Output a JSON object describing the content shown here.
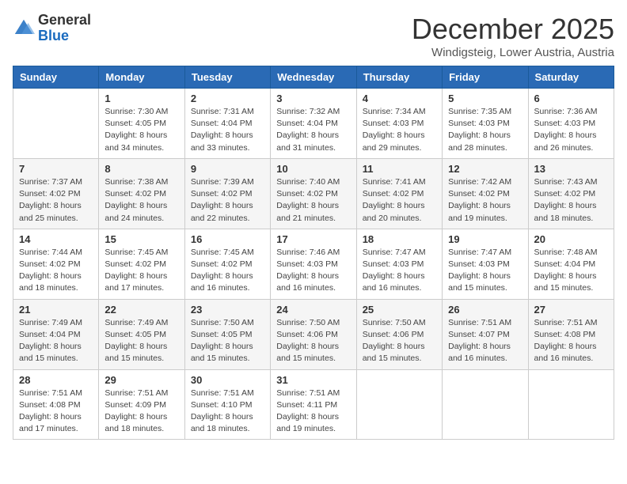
{
  "logo": {
    "general": "General",
    "blue": "Blue"
  },
  "title": "December 2025",
  "location": "Windigsteig, Lower Austria, Austria",
  "days_of_week": [
    "Sunday",
    "Monday",
    "Tuesday",
    "Wednesday",
    "Thursday",
    "Friday",
    "Saturday"
  ],
  "weeks": [
    [
      {
        "day": "",
        "info": ""
      },
      {
        "day": "1",
        "info": "Sunrise: 7:30 AM\nSunset: 4:05 PM\nDaylight: 8 hours\nand 34 minutes."
      },
      {
        "day": "2",
        "info": "Sunrise: 7:31 AM\nSunset: 4:04 PM\nDaylight: 8 hours\nand 33 minutes."
      },
      {
        "day": "3",
        "info": "Sunrise: 7:32 AM\nSunset: 4:04 PM\nDaylight: 8 hours\nand 31 minutes."
      },
      {
        "day": "4",
        "info": "Sunrise: 7:34 AM\nSunset: 4:03 PM\nDaylight: 8 hours\nand 29 minutes."
      },
      {
        "day": "5",
        "info": "Sunrise: 7:35 AM\nSunset: 4:03 PM\nDaylight: 8 hours\nand 28 minutes."
      },
      {
        "day": "6",
        "info": "Sunrise: 7:36 AM\nSunset: 4:03 PM\nDaylight: 8 hours\nand 26 minutes."
      }
    ],
    [
      {
        "day": "7",
        "info": "Sunrise: 7:37 AM\nSunset: 4:02 PM\nDaylight: 8 hours\nand 25 minutes."
      },
      {
        "day": "8",
        "info": "Sunrise: 7:38 AM\nSunset: 4:02 PM\nDaylight: 8 hours\nand 24 minutes."
      },
      {
        "day": "9",
        "info": "Sunrise: 7:39 AM\nSunset: 4:02 PM\nDaylight: 8 hours\nand 22 minutes."
      },
      {
        "day": "10",
        "info": "Sunrise: 7:40 AM\nSunset: 4:02 PM\nDaylight: 8 hours\nand 21 minutes."
      },
      {
        "day": "11",
        "info": "Sunrise: 7:41 AM\nSunset: 4:02 PM\nDaylight: 8 hours\nand 20 minutes."
      },
      {
        "day": "12",
        "info": "Sunrise: 7:42 AM\nSunset: 4:02 PM\nDaylight: 8 hours\nand 19 minutes."
      },
      {
        "day": "13",
        "info": "Sunrise: 7:43 AM\nSunset: 4:02 PM\nDaylight: 8 hours\nand 18 minutes."
      }
    ],
    [
      {
        "day": "14",
        "info": "Sunrise: 7:44 AM\nSunset: 4:02 PM\nDaylight: 8 hours\nand 18 minutes."
      },
      {
        "day": "15",
        "info": "Sunrise: 7:45 AM\nSunset: 4:02 PM\nDaylight: 8 hours\nand 17 minutes."
      },
      {
        "day": "16",
        "info": "Sunrise: 7:45 AM\nSunset: 4:02 PM\nDaylight: 8 hours\nand 16 minutes."
      },
      {
        "day": "17",
        "info": "Sunrise: 7:46 AM\nSunset: 4:03 PM\nDaylight: 8 hours\nand 16 minutes."
      },
      {
        "day": "18",
        "info": "Sunrise: 7:47 AM\nSunset: 4:03 PM\nDaylight: 8 hours\nand 16 minutes."
      },
      {
        "day": "19",
        "info": "Sunrise: 7:47 AM\nSunset: 4:03 PM\nDaylight: 8 hours\nand 15 minutes."
      },
      {
        "day": "20",
        "info": "Sunrise: 7:48 AM\nSunset: 4:04 PM\nDaylight: 8 hours\nand 15 minutes."
      }
    ],
    [
      {
        "day": "21",
        "info": "Sunrise: 7:49 AM\nSunset: 4:04 PM\nDaylight: 8 hours\nand 15 minutes."
      },
      {
        "day": "22",
        "info": "Sunrise: 7:49 AM\nSunset: 4:05 PM\nDaylight: 8 hours\nand 15 minutes."
      },
      {
        "day": "23",
        "info": "Sunrise: 7:50 AM\nSunset: 4:05 PM\nDaylight: 8 hours\nand 15 minutes."
      },
      {
        "day": "24",
        "info": "Sunrise: 7:50 AM\nSunset: 4:06 PM\nDaylight: 8 hours\nand 15 minutes."
      },
      {
        "day": "25",
        "info": "Sunrise: 7:50 AM\nSunset: 4:06 PM\nDaylight: 8 hours\nand 15 minutes."
      },
      {
        "day": "26",
        "info": "Sunrise: 7:51 AM\nSunset: 4:07 PM\nDaylight: 8 hours\nand 16 minutes."
      },
      {
        "day": "27",
        "info": "Sunrise: 7:51 AM\nSunset: 4:08 PM\nDaylight: 8 hours\nand 16 minutes."
      }
    ],
    [
      {
        "day": "28",
        "info": "Sunrise: 7:51 AM\nSunset: 4:08 PM\nDaylight: 8 hours\nand 17 minutes."
      },
      {
        "day": "29",
        "info": "Sunrise: 7:51 AM\nSunset: 4:09 PM\nDaylight: 8 hours\nand 18 minutes."
      },
      {
        "day": "30",
        "info": "Sunrise: 7:51 AM\nSunset: 4:10 PM\nDaylight: 8 hours\nand 18 minutes."
      },
      {
        "day": "31",
        "info": "Sunrise: 7:51 AM\nSunset: 4:11 PM\nDaylight: 8 hours\nand 19 minutes."
      },
      {
        "day": "",
        "info": ""
      },
      {
        "day": "",
        "info": ""
      },
      {
        "day": "",
        "info": ""
      }
    ]
  ]
}
